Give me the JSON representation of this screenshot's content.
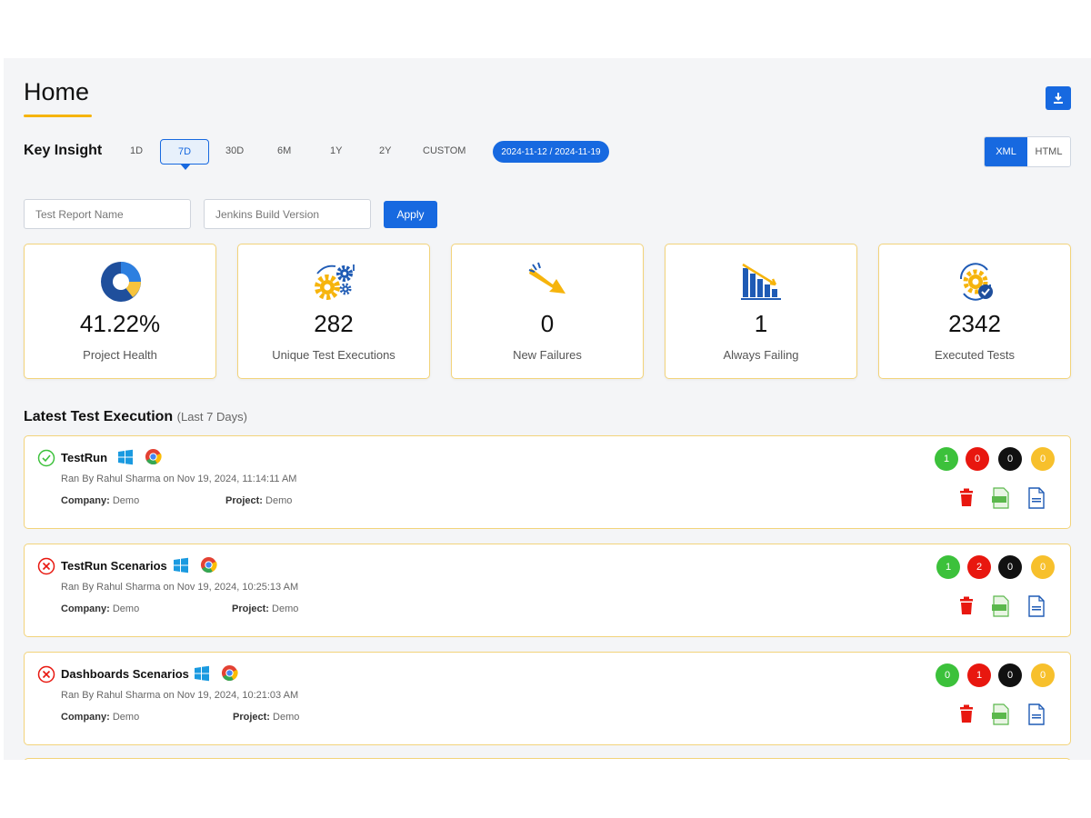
{
  "page": {
    "title": "Home"
  },
  "insight": {
    "label": "Key Insight",
    "ranges": [
      "1D",
      "7D",
      "30D",
      "6M",
      "1Y",
      "2Y",
      "CUSTOM"
    ],
    "active_range": "7D",
    "date_range": "2024-11-12 / 2024-11-19",
    "formats": [
      "XML",
      "HTML"
    ],
    "active_format": "XML"
  },
  "filters": {
    "report_name_placeholder": "Test Report Name",
    "build_placeholder": "Jenkins Build Version",
    "apply_label": "Apply"
  },
  "stats": [
    {
      "value": "41.22%",
      "label": "Project Health",
      "icon": "pie-chart-icon"
    },
    {
      "value": "282",
      "label": "Unique Test Executions",
      "icon": "gears-icon"
    },
    {
      "value": "0",
      "label": "New Failures",
      "icon": "downtrend-arrow-icon"
    },
    {
      "value": "1",
      "label": "Always Failing",
      "icon": "declining-bars-icon"
    },
    {
      "value": "2342",
      "label": "Executed Tests",
      "icon": "gear-check-icon"
    }
  ],
  "executions_section": {
    "title": "Latest Test Execution",
    "subtitle": "(Last 7 Days)"
  },
  "executions": [
    {
      "name": "TestRun",
      "status": "passed",
      "ran_by": "Ran By Rahul Sharma on Nov 19, 2024, 11:14:11 AM",
      "company_label": "Company:",
      "company": "Demo",
      "project_label": "Project:",
      "project": "Demo",
      "counts": {
        "passed": "1",
        "failed": "0",
        "skipped": "0",
        "other": "0"
      }
    },
    {
      "name": "TestRun Scenarios",
      "status": "failed",
      "ran_by": "Ran By Rahul Sharma on Nov 19, 2024, 10:25:13 AM",
      "company_label": "Company:",
      "company": "Demo",
      "project_label": "Project:",
      "project": "Demo",
      "counts": {
        "passed": "1",
        "failed": "2",
        "skipped": "0",
        "other": "0"
      }
    },
    {
      "name": "Dashboards Scenarios",
      "status": "failed",
      "ran_by": "Ran By Rahul Sharma on Nov 19, 2024, 10:21:03 AM",
      "company_label": "Company:",
      "company": "Demo",
      "project_label": "Project:",
      "project": "Demo",
      "counts": {
        "passed": "0",
        "failed": "1",
        "skipped": "0",
        "other": "0"
      }
    }
  ],
  "colors": {
    "accent": "#1769e0",
    "title_underline": "#f6b40c",
    "card_border": "#f2d37a",
    "passed": "#3cc13b",
    "failed": "#e8170f",
    "skipped": "#111111",
    "other": "#f7c02c"
  }
}
